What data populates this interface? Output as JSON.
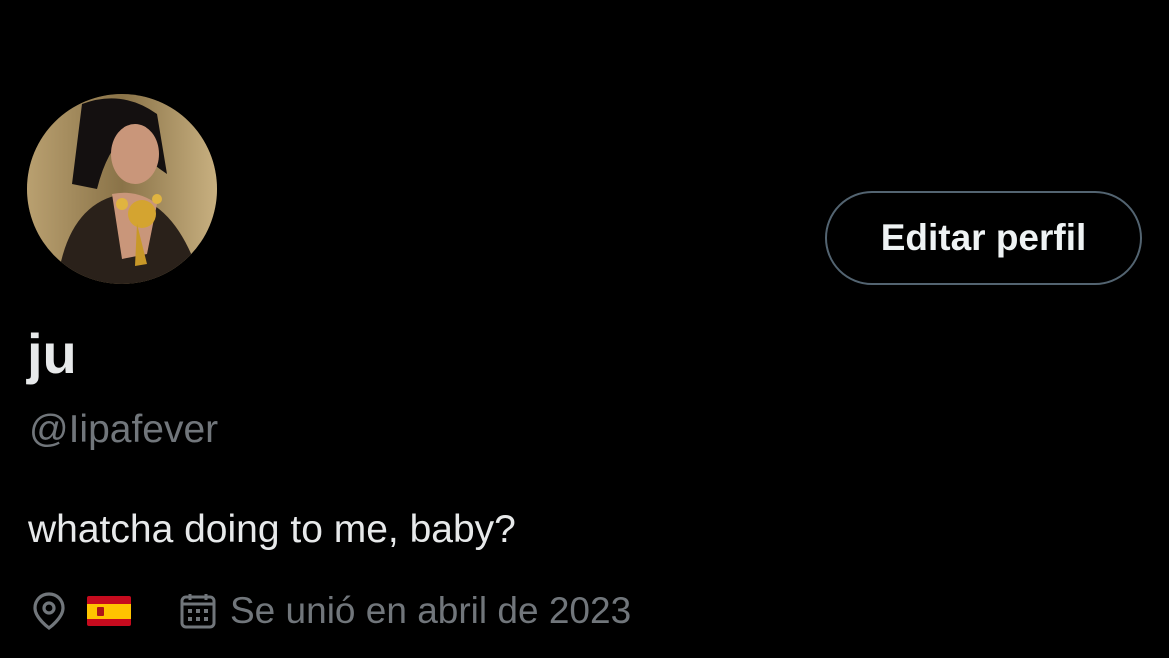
{
  "profile": {
    "display_name": "ju",
    "handle": "@Iipafever",
    "bio": "whatcha doing to me, baby?",
    "edit_button_label": "Editar perfil",
    "avatar": "avatar-photo",
    "location_icon": "location-pin-icon",
    "location_flag": "spain-flag",
    "calendar_icon": "calendar-icon",
    "joined_text": "Se unió en abril de 2023"
  },
  "colors": {
    "background": "#000000",
    "primary_text": "#e7e9ea",
    "secondary_text": "#71767b",
    "button_border": "#536471"
  }
}
